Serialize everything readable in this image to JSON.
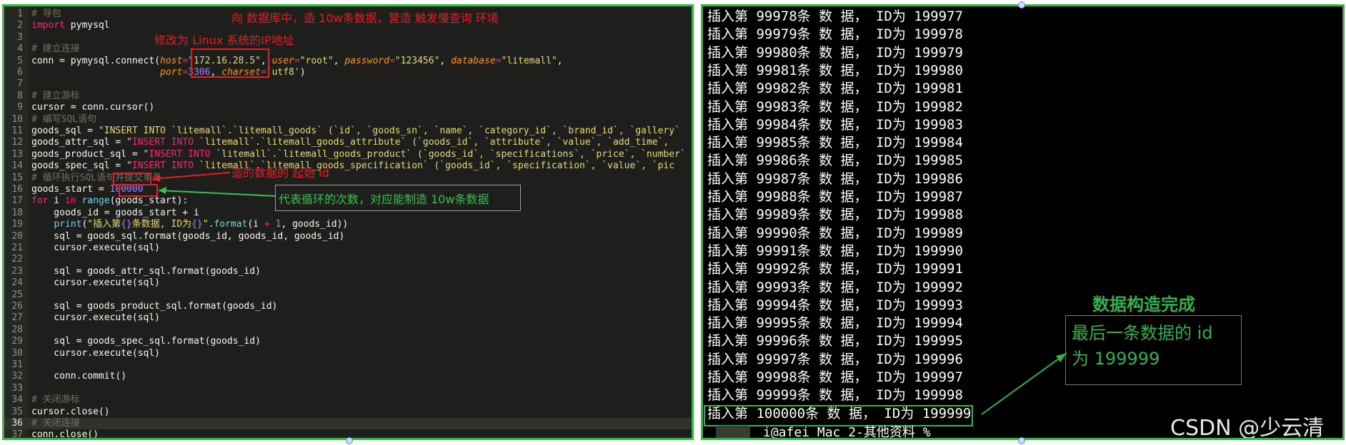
{
  "editor": {
    "lines": [
      [
        [
          "c",
          "# 导包"
        ]
      ],
      [
        [
          "k",
          "import"
        ],
        [
          "t",
          " pymysql"
        ]
      ],
      [],
      [
        [
          "c",
          "# 建立连接"
        ]
      ],
      [
        [
          "t",
          "conn = pymysql.connect("
        ],
        [
          "p",
          "host"
        ],
        [
          "k",
          "="
        ],
        [
          "s",
          "\"172.16.28.5\""
        ],
        [
          "t",
          ", "
        ],
        [
          "p",
          "user"
        ],
        [
          "k",
          "="
        ],
        [
          "s",
          "\"root\""
        ],
        [
          "t",
          ", "
        ],
        [
          "p",
          "password"
        ],
        [
          "k",
          "="
        ],
        [
          "s",
          "\"123456\""
        ],
        [
          "t",
          ", "
        ],
        [
          "p",
          "database"
        ],
        [
          "k",
          "="
        ],
        [
          "s",
          "\"litemall\""
        ],
        [
          "t",
          ","
        ]
      ],
      [
        [
          "t",
          "                       "
        ],
        [
          "p",
          "port"
        ],
        [
          "k",
          "="
        ],
        [
          "n",
          "3306"
        ],
        [
          "t",
          ", "
        ],
        [
          "p",
          "charset"
        ],
        [
          "k",
          "="
        ],
        [
          "s",
          "'utf8'"
        ],
        [
          "t",
          ")"
        ]
      ],
      [],
      [
        [
          "c",
          "# 建立游标"
        ]
      ],
      [
        [
          "t",
          "cursor = conn.cursor()"
        ]
      ],
      [
        [
          "c",
          "# 编写SQL语句"
        ]
      ],
      [
        [
          "t",
          "goods_sql = "
        ],
        [
          "s",
          "\"INSERT INTO `litemall`.`litemall_goods` (`id`, `goods_sn`, `name`, `category_id`, `brand_id`, `gallery`"
        ]
      ],
      [
        [
          "t",
          "goods_attr_sql = "
        ],
        [
          "s",
          "\""
        ],
        [
          "k",
          "INSERT INTO"
        ],
        [
          "s",
          " `litemall`.`litemall_goods_attribute` (`goods_id`, `attribute`, `value`, `add_time`,"
        ]
      ],
      [
        [
          "t",
          "goods_product_sql = "
        ],
        [
          "s",
          "\""
        ],
        [
          "k",
          "INSERT INTO"
        ],
        [
          "s",
          " `litemall`.`litemall_goods_product` (`goods_id`, `specifications`, `price`, `number`"
        ]
      ],
      [
        [
          "t",
          "goods_spec_sql = "
        ],
        [
          "s",
          "\""
        ],
        [
          "k",
          "INSERT INTO"
        ],
        [
          "s",
          " `litemall`.`litemall_goods_specification` (`goods_id`, `specification`, `value`, `pic"
        ]
      ],
      [
        [
          "c",
          "# 循环执行SQL语句并提交事务"
        ]
      ],
      [
        [
          "t",
          "goods_start = "
        ],
        [
          "n",
          "100000"
        ]
      ],
      [
        [
          "k",
          "for"
        ],
        [
          "t",
          " i "
        ],
        [
          "k",
          "in"
        ],
        [
          "t",
          " "
        ],
        [
          "b",
          "range"
        ],
        [
          "t",
          "("
        ],
        [
          "t",
          "goods_start"
        ],
        [
          "t",
          "):"
        ]
      ],
      [
        [
          "t",
          "    goods_id = goods_start + i"
        ]
      ],
      [
        [
          "t",
          "    "
        ],
        [
          "b",
          "print"
        ],
        [
          "t",
          "("
        ],
        [
          "s",
          "\"插入第"
        ],
        [
          "n",
          "{}"
        ],
        [
          "s",
          "条数据, ID为"
        ],
        [
          "n",
          "{}"
        ],
        [
          "s",
          "\""
        ],
        [
          "t",
          "."
        ],
        [
          "b",
          "format"
        ],
        [
          "t",
          "(i "
        ],
        [
          "k",
          "+"
        ],
        [
          "t",
          " "
        ],
        [
          "n",
          "1"
        ],
        [
          "t",
          ", goods_id))"
        ]
      ],
      [
        [
          "t",
          "    sql = goods_sql.format(goods_id, goods_id, goods_id)"
        ]
      ],
      [
        [
          "t",
          "    cursor.execute(sql)"
        ]
      ],
      [],
      [
        [
          "t",
          "    sql = goods_attr_sql.format(goods_id)"
        ]
      ],
      [
        [
          "t",
          "    cursor.execute(sql)"
        ]
      ],
      [],
      [
        [
          "t",
          "    sql = goods_product_sql.format(goods_id)"
        ]
      ],
      [
        [
          "t",
          "    cursor.execute(sql)"
        ]
      ],
      [],
      [
        [
          "t",
          "    sql = goods_spec_sql.format(goods_id)"
        ]
      ],
      [
        [
          "t",
          "    cursor.execute(sql)"
        ]
      ],
      [],
      [
        [
          "t",
          "    conn.commit()"
        ]
      ],
      [],
      [
        [
          "c",
          "# 关闭游标"
        ]
      ],
      [
        [
          "t",
          "cursor.close()"
        ]
      ],
      [
        [
          "c",
          "# 关闭连接"
        ]
      ],
      [
        [
          "t",
          "conn.close()"
        ]
      ],
      []
    ],
    "current_line": 36,
    "annotations": {
      "top": "向 数据库中，造 10w条数据，营造 触发慢查询 环境",
      "ip": "修改为 Linux 系统的IP地址",
      "start": "造的数据的 起始 id",
      "loop": "代表循环的次数，对应能制造 10w条数据"
    }
  },
  "terminal": {
    "lines": [
      "插入第 99978条 数 据， ID为 199977",
      "插入第 99979条 数 据， ID为 199978",
      "插入第 99980条 数 据， ID为 199979",
      "插入第 99981条 数 据， ID为 199980",
      "插入第 99982条 数 据， ID为 199981",
      "插入第 99983条 数 据， ID为 199982",
      "插入第 99984条 数 据， ID为 199983",
      "插入第 99985条 数 据， ID为 199984",
      "插入第 99986条 数 据， ID为 199985",
      "插入第 99987条 数 据， ID为 199986",
      "插入第 99988条 数 据， ID为 199987",
      "插入第 99989条 数 据， ID为 199988",
      "插入第 99990条 数 据， ID为 199989",
      "插入第 99991条 数 据， ID为 199990",
      "插入第 99992条 数 据， ID为 199991",
      "插入第 99993条 数 据， ID为 199992",
      "插入第 99994条 数 据， ID为 199993",
      "插入第 99995条 数 据， ID为 199994",
      "插入第 99996条 数 据， ID为 199995",
      "插入第 99997条 数 据， ID为 199996",
      "插入第 99998条 数 据， ID为 199997",
      "插入第 99999条 数 据， ID为 199998",
      "插入第 100000条 数 据， ID为 199999"
    ],
    "prompt": "i@afei Mac 2-其他资料 %",
    "done_title": "数据构造完成",
    "done_line1": "最后一条数据的 id",
    "done_line2": "为 199999",
    "watermark": "CSDN @少云清"
  },
  "colors": {
    "frame": "#37b34a",
    "annotation_red": "#e21f26",
    "annotation_green": "#2fb24a",
    "editor_bg": "#1e1f1c",
    "terminal_bg": "#000000"
  }
}
